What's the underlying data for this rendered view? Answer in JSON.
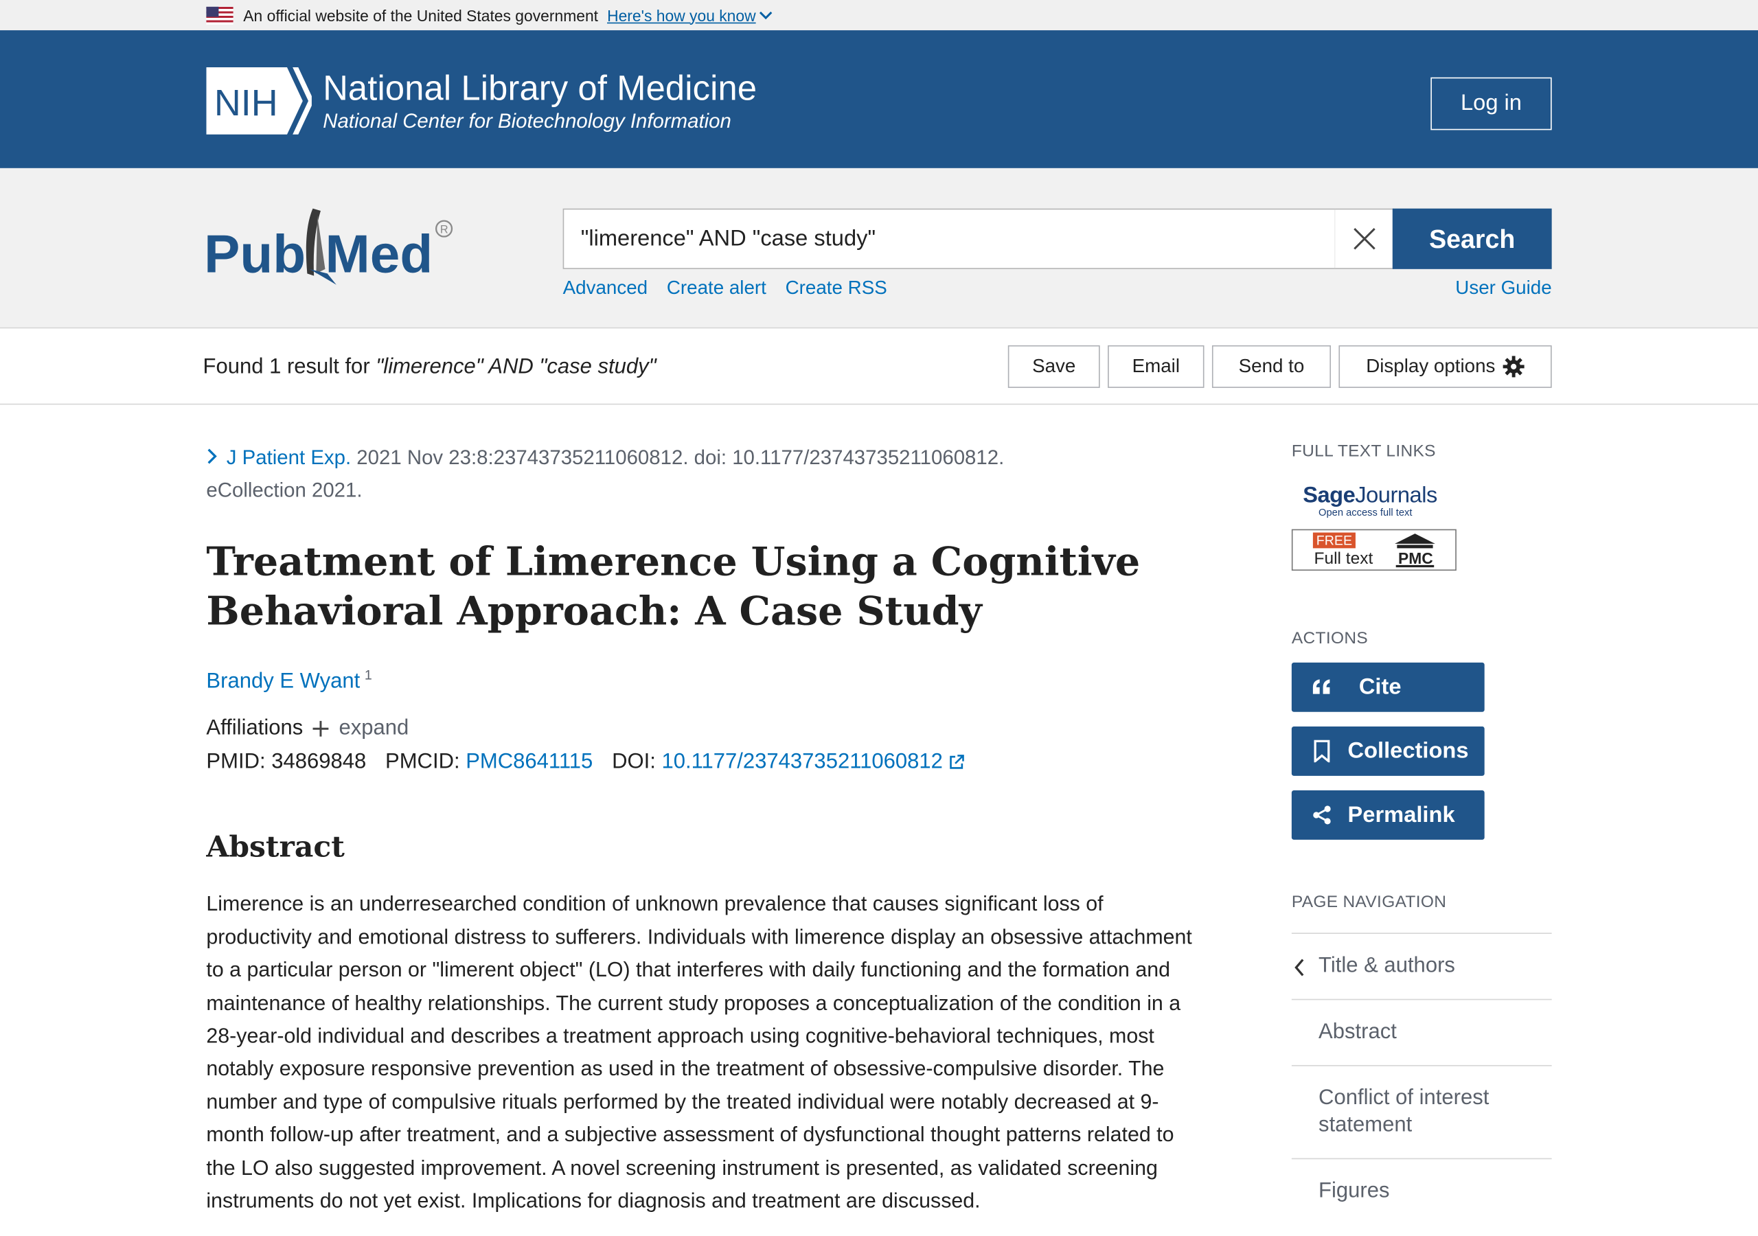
{
  "gov_banner": {
    "text": "An official website of the United States government",
    "link": "Here's how you know"
  },
  "header": {
    "nih_badge": "NIH",
    "title": "National Library of Medicine",
    "subtitle": "National Center for Biotechnology Information",
    "login": "Log in"
  },
  "search": {
    "logo_text": "PubMed",
    "value": "\"limerence\" AND \"case study\"",
    "button": "Search",
    "links": [
      "Advanced",
      "Create alert",
      "Create RSS"
    ],
    "user_guide": "User Guide"
  },
  "results": {
    "found_prefix": "Found 1 result for ",
    "query": "\"limerence\" AND \"case study\"",
    "toolbar": [
      "Save",
      "Email",
      "Send to",
      "Display options"
    ]
  },
  "article": {
    "journal": "J Patient Exp.",
    "citation": " 2021 Nov 23:8:23743735211060812. doi: 10.1177/23743735211060812.",
    "citation2": "eCollection 2021.",
    "title": "Treatment of Limerence Using a Cognitive Behavioral Approach: A Case Study",
    "author": "Brandy E Wyant",
    "author_sup": "1",
    "affiliations_label": "Affiliations",
    "affiliations_expand": "expand",
    "pmid_label": "PMID:",
    "pmid": "34869848",
    "pmcid_label": "PMCID:",
    "pmcid": "PMC8641115",
    "doi_label": "DOI:",
    "doi": "10.1177/23743735211060812",
    "abstract_heading": "Abstract",
    "abstract": "Limerence is an underresearched condition of unknown prevalence that causes significant loss of productivity and emotional distress to sufferers. Individuals with limerence display an obsessive attachment to a particular person or \"limerent object\" (LO) that interferes with daily functioning and the formation and maintenance of healthy relationships. The current study proposes a conceptualization of the condition in a 28-year-old individual and describes a treatment approach using cognitive-behavioral techniques, most notably exposure responsive prevention as used in the treatment of obsessive-compulsive disorder. The number and type of compulsive rituals performed by the treated individual were notably decreased at 9-month follow-up after treatment, and a subjective assessment of dysfunctional thought patterns related to the LO also suggested improvement. A novel screening instrument is presented, as validated screening instruments do not yet exist. Implications for diagnosis and treatment are discussed."
  },
  "sidebar": {
    "full_text_heading": "FULL TEXT LINKS",
    "sage_bold": "Sage",
    "sage_regular": "Journals",
    "sage_sub": "Open access full text",
    "pmc_free": "FREE",
    "pmc_full": "Full text",
    "pmc_label": "PMC",
    "actions_heading": "ACTIONS",
    "actions": [
      "Cite",
      "Collections",
      "Permalink"
    ],
    "nav_heading": "PAGE NAVIGATION",
    "nav": [
      "Title & authors",
      "Abstract",
      "Conflict of interest statement",
      "Figures"
    ]
  },
  "colors": {
    "header_blue": "#20558a",
    "link_blue": "#0071bc",
    "free_orange": "#d9542c"
  }
}
